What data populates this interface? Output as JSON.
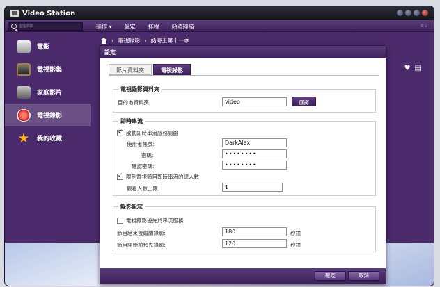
{
  "app": {
    "title": "Video Station"
  },
  "toolbar": {
    "search_placeholder": "關鍵字",
    "menu": [
      "操作 ▾",
      "設定",
      "排程",
      "頻道掃描"
    ],
    "right_hint": "≡↓"
  },
  "sidebar": {
    "items": [
      {
        "label": "電影",
        "icon": "movie-clapper-icon"
      },
      {
        "label": "電視影集",
        "icon": "tv-icon"
      },
      {
        "label": "家庭影片",
        "icon": "home-video-icon"
      },
      {
        "label": "電視錄影",
        "icon": "recording-icon",
        "active": true
      },
      {
        "label": "我的收藏",
        "icon": "star-icon"
      }
    ]
  },
  "breadcrumb": {
    "sep": "›",
    "items": [
      "電視錄影",
      "熱海王第十一季"
    ]
  },
  "dialog": {
    "title": "設定",
    "tabs": [
      "影片資料夾",
      "電視錄影"
    ],
    "active_tab": 1,
    "folder_section": {
      "title": "電視錄影資料夾",
      "dest_label": "目的地資料夾:",
      "dest_value": "video",
      "select_button": "選擇"
    },
    "stream_section": {
      "title": "即時串流",
      "enable_auth_label": "啟動即時串流服務認證",
      "enable_auth_checked": true,
      "username_label": "使用者帳號:",
      "username_value": "DarkAlex",
      "password_label": "密碼:",
      "password_value": "••••••••",
      "confirm_label": "確認密碼:",
      "confirm_value": "••••••••",
      "limit_label": "限制電視節目即時串流的總人數",
      "limit_checked": true,
      "max_viewers_label": "觀看人數上限:",
      "max_viewers_value": "1"
    },
    "record_section": {
      "title": "錄影設定",
      "priority_label": "電視錄影優先於串流服務",
      "priority_checked": false,
      "after_label": "節目結束後繼續錄影:",
      "after_value": "180",
      "before_label": "節目開始前預先錄影:",
      "before_value": "120",
      "unit": "秒鐘"
    },
    "ok_button": "確定",
    "cancel_button": "取消"
  }
}
